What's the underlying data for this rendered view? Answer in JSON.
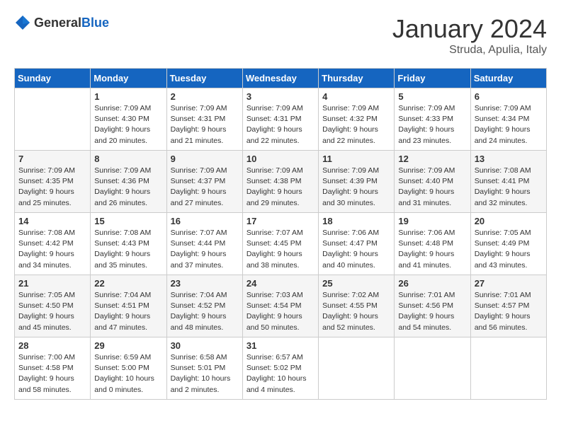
{
  "header": {
    "logo_general": "General",
    "logo_blue": "Blue",
    "title": "January 2024",
    "subtitle": "Struda, Apulia, Italy"
  },
  "days_of_week": [
    "Sunday",
    "Monday",
    "Tuesday",
    "Wednesday",
    "Thursday",
    "Friday",
    "Saturday"
  ],
  "weeks": [
    [
      {
        "day": "",
        "info": ""
      },
      {
        "day": "1",
        "info": "Sunrise: 7:09 AM\nSunset: 4:30 PM\nDaylight: 9 hours\nand 20 minutes."
      },
      {
        "day": "2",
        "info": "Sunrise: 7:09 AM\nSunset: 4:31 PM\nDaylight: 9 hours\nand 21 minutes."
      },
      {
        "day": "3",
        "info": "Sunrise: 7:09 AM\nSunset: 4:31 PM\nDaylight: 9 hours\nand 22 minutes."
      },
      {
        "day": "4",
        "info": "Sunrise: 7:09 AM\nSunset: 4:32 PM\nDaylight: 9 hours\nand 22 minutes."
      },
      {
        "day": "5",
        "info": "Sunrise: 7:09 AM\nSunset: 4:33 PM\nDaylight: 9 hours\nand 23 minutes."
      },
      {
        "day": "6",
        "info": "Sunrise: 7:09 AM\nSunset: 4:34 PM\nDaylight: 9 hours\nand 24 minutes."
      }
    ],
    [
      {
        "day": "7",
        "info": "Sunrise: 7:09 AM\nSunset: 4:35 PM\nDaylight: 9 hours\nand 25 minutes."
      },
      {
        "day": "8",
        "info": "Sunrise: 7:09 AM\nSunset: 4:36 PM\nDaylight: 9 hours\nand 26 minutes."
      },
      {
        "day": "9",
        "info": "Sunrise: 7:09 AM\nSunset: 4:37 PM\nDaylight: 9 hours\nand 27 minutes."
      },
      {
        "day": "10",
        "info": "Sunrise: 7:09 AM\nSunset: 4:38 PM\nDaylight: 9 hours\nand 29 minutes."
      },
      {
        "day": "11",
        "info": "Sunrise: 7:09 AM\nSunset: 4:39 PM\nDaylight: 9 hours\nand 30 minutes."
      },
      {
        "day": "12",
        "info": "Sunrise: 7:09 AM\nSunset: 4:40 PM\nDaylight: 9 hours\nand 31 minutes."
      },
      {
        "day": "13",
        "info": "Sunrise: 7:08 AM\nSunset: 4:41 PM\nDaylight: 9 hours\nand 32 minutes."
      }
    ],
    [
      {
        "day": "14",
        "info": "Sunrise: 7:08 AM\nSunset: 4:42 PM\nDaylight: 9 hours\nand 34 minutes."
      },
      {
        "day": "15",
        "info": "Sunrise: 7:08 AM\nSunset: 4:43 PM\nDaylight: 9 hours\nand 35 minutes."
      },
      {
        "day": "16",
        "info": "Sunrise: 7:07 AM\nSunset: 4:44 PM\nDaylight: 9 hours\nand 37 minutes."
      },
      {
        "day": "17",
        "info": "Sunrise: 7:07 AM\nSunset: 4:45 PM\nDaylight: 9 hours\nand 38 minutes."
      },
      {
        "day": "18",
        "info": "Sunrise: 7:06 AM\nSunset: 4:47 PM\nDaylight: 9 hours\nand 40 minutes."
      },
      {
        "day": "19",
        "info": "Sunrise: 7:06 AM\nSunset: 4:48 PM\nDaylight: 9 hours\nand 41 minutes."
      },
      {
        "day": "20",
        "info": "Sunrise: 7:05 AM\nSunset: 4:49 PM\nDaylight: 9 hours\nand 43 minutes."
      }
    ],
    [
      {
        "day": "21",
        "info": "Sunrise: 7:05 AM\nSunset: 4:50 PM\nDaylight: 9 hours\nand 45 minutes."
      },
      {
        "day": "22",
        "info": "Sunrise: 7:04 AM\nSunset: 4:51 PM\nDaylight: 9 hours\nand 47 minutes."
      },
      {
        "day": "23",
        "info": "Sunrise: 7:04 AM\nSunset: 4:52 PM\nDaylight: 9 hours\nand 48 minutes."
      },
      {
        "day": "24",
        "info": "Sunrise: 7:03 AM\nSunset: 4:54 PM\nDaylight: 9 hours\nand 50 minutes."
      },
      {
        "day": "25",
        "info": "Sunrise: 7:02 AM\nSunset: 4:55 PM\nDaylight: 9 hours\nand 52 minutes."
      },
      {
        "day": "26",
        "info": "Sunrise: 7:01 AM\nSunset: 4:56 PM\nDaylight: 9 hours\nand 54 minutes."
      },
      {
        "day": "27",
        "info": "Sunrise: 7:01 AM\nSunset: 4:57 PM\nDaylight: 9 hours\nand 56 minutes."
      }
    ],
    [
      {
        "day": "28",
        "info": "Sunrise: 7:00 AM\nSunset: 4:58 PM\nDaylight: 9 hours\nand 58 minutes."
      },
      {
        "day": "29",
        "info": "Sunrise: 6:59 AM\nSunset: 5:00 PM\nDaylight: 10 hours\nand 0 minutes."
      },
      {
        "day": "30",
        "info": "Sunrise: 6:58 AM\nSunset: 5:01 PM\nDaylight: 10 hours\nand 2 minutes."
      },
      {
        "day": "31",
        "info": "Sunrise: 6:57 AM\nSunset: 5:02 PM\nDaylight: 10 hours\nand 4 minutes."
      },
      {
        "day": "",
        "info": ""
      },
      {
        "day": "",
        "info": ""
      },
      {
        "day": "",
        "info": ""
      }
    ]
  ]
}
